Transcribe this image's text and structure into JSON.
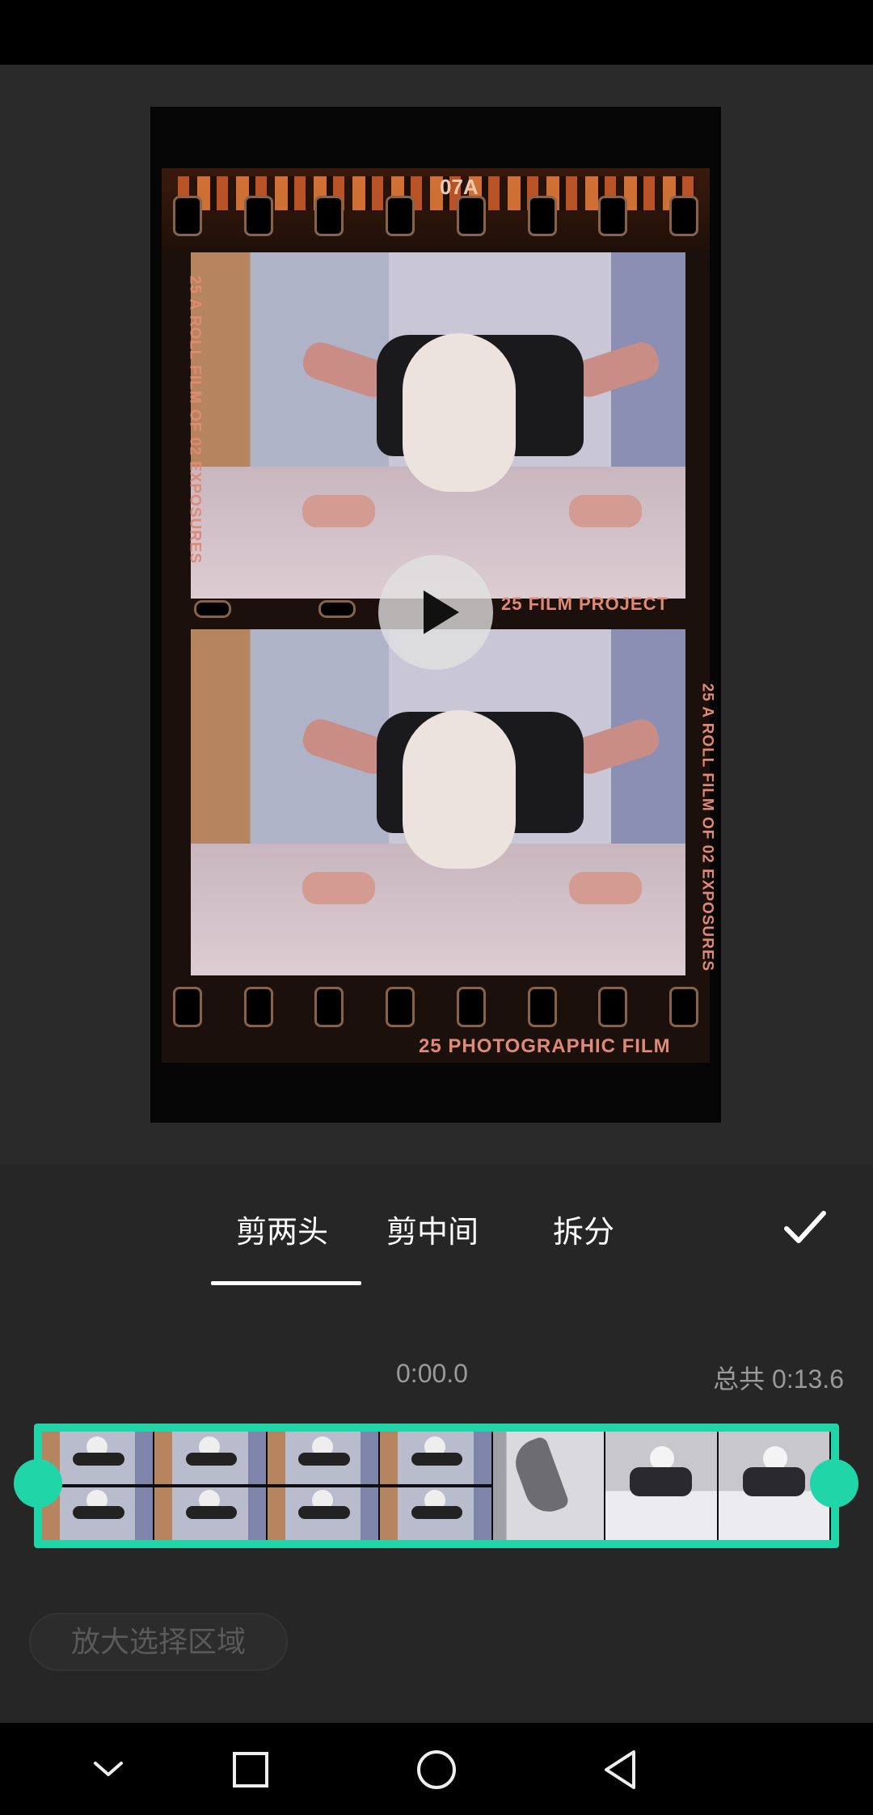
{
  "film": {
    "frame_code": "07A",
    "side_text": "25  A ROLL FILM OF 02 EXPOSURES",
    "middle_caption": "25  FILM PROJECT",
    "bottom_caption": "25  PHOTOGRAPHIC FILM"
  },
  "tabs": [
    {
      "label": "剪两头",
      "active": true
    },
    {
      "label": "剪中间",
      "active": false
    },
    {
      "label": "拆分",
      "active": false
    }
  ],
  "timeline": {
    "current_time": "0:00.0",
    "total_label": "总共 0:13.6",
    "accent_color": "#20d6a8"
  },
  "zoom_button_label": "放大选择区域",
  "icons": {
    "play": "play-icon",
    "confirm": "checkmark-icon",
    "nav": [
      "chevron-down-icon",
      "square-icon",
      "circle-icon",
      "triangle-back-icon"
    ]
  }
}
